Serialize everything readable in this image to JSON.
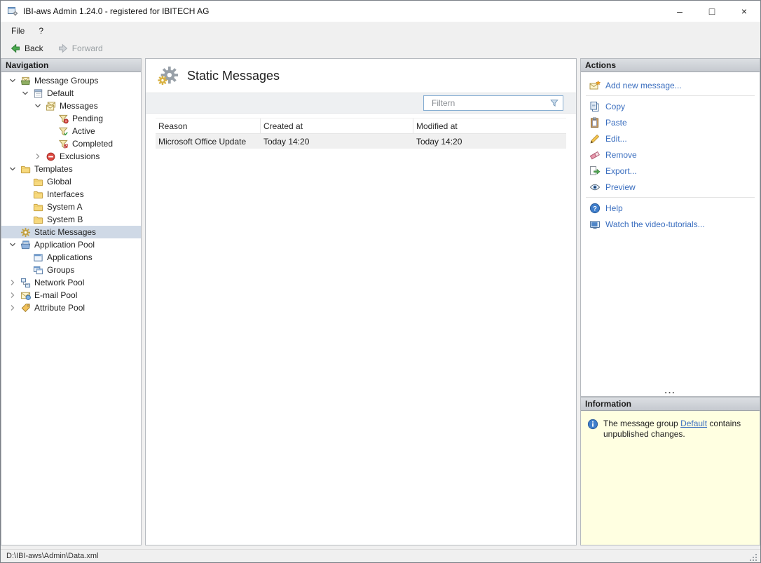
{
  "colors": {
    "action_link_blue": "#3a6ebf",
    "info_panel_bg": "#ffffe1",
    "selected_tree_item_bg": "#cfd9e6",
    "panel_header_gradient_top": "#dcdfe3",
    "panel_header_gradient_bottom": "#c5c9cf",
    "back_arrow_green": "#4aa94f",
    "row_highlight_gray": "#f0f0f0"
  },
  "window": {
    "title": "IBI-aws Admin 1.24.0 - registered for IBITECH AG",
    "controls": {
      "minimize": "–",
      "maximize": "□",
      "close": "×"
    }
  },
  "menu_bar": {
    "items": [
      {
        "label": "File"
      },
      {
        "label": "?"
      }
    ]
  },
  "toolbar": {
    "back_label": "Back",
    "forward_label": "Forward",
    "forward_enabled": false
  },
  "navigation": {
    "header": "Navigation",
    "tree": [
      {
        "label": "Message Groups",
        "icon": "message-groups-icon",
        "level": 0,
        "state": "expanded"
      },
      {
        "label": "Default",
        "icon": "message-group-icon",
        "level": 1,
        "state": "expanded"
      },
      {
        "label": "Messages",
        "icon": "messages-icon",
        "level": 2,
        "state": "expanded"
      },
      {
        "label": "Pending",
        "icon": "pending-filter-icon",
        "level": 3,
        "state": "leaf"
      },
      {
        "label": "Active",
        "icon": "active-filter-icon",
        "level": 3,
        "state": "leaf"
      },
      {
        "label": "Completed",
        "icon": "completed-filter-icon",
        "level": 3,
        "state": "leaf"
      },
      {
        "label": "Exclusions",
        "icon": "exclusions-icon",
        "level": 2,
        "state": "collapsed"
      },
      {
        "label": "Templates",
        "icon": "folder-icon",
        "level": 0,
        "state": "expanded"
      },
      {
        "label": "Global",
        "icon": "folder-icon",
        "level": 1,
        "state": "leaf"
      },
      {
        "label": "Interfaces",
        "icon": "folder-icon",
        "level": 1,
        "state": "leaf"
      },
      {
        "label": "System A",
        "icon": "folder-icon",
        "level": 1,
        "state": "leaf"
      },
      {
        "label": "System B",
        "icon": "folder-icon",
        "level": 1,
        "state": "leaf"
      },
      {
        "label": "Static Messages",
        "icon": "gear-icon",
        "level": 0,
        "state": "leaf",
        "selected": true
      },
      {
        "label": "Application Pool",
        "icon": "application-pool-icon",
        "level": 0,
        "state": "expanded"
      },
      {
        "label": "Applications",
        "icon": "applications-icon",
        "level": 1,
        "state": "leaf"
      },
      {
        "label": "Groups",
        "icon": "groups-icon",
        "level": 1,
        "state": "leaf"
      },
      {
        "label": "Network Pool",
        "icon": "network-pool-icon",
        "level": 0,
        "state": "collapsed"
      },
      {
        "label": "E-mail Pool",
        "icon": "email-pool-icon",
        "level": 0,
        "state": "collapsed"
      },
      {
        "label": "Attribute Pool",
        "icon": "attribute-pool-icon",
        "level": 0,
        "state": "collapsed"
      }
    ]
  },
  "main": {
    "title": "Static Messages",
    "title_icon": "gears-icon",
    "filter": {
      "placeholder": "Filtern",
      "icon": "filter-funnel-icon"
    },
    "table": {
      "columns": [
        "Reason",
        "Created at",
        "Modified at"
      ],
      "rows": [
        {
          "reason": "Microsoft Office Update",
          "created_at": "Today 14:20",
          "modified_at": "Today 14:20"
        }
      ]
    }
  },
  "actions": {
    "header": "Actions",
    "overflow": "...",
    "groups": [
      {
        "items": [
          {
            "label": "Add new message...",
            "icon": "new-message-icon"
          }
        ]
      },
      {
        "items": [
          {
            "label": "Copy",
            "icon": "copy-icon"
          },
          {
            "label": "Paste",
            "icon": "paste-icon"
          },
          {
            "label": "Edit...",
            "icon": "edit-pencil-icon"
          },
          {
            "label": "Remove",
            "icon": "remove-eraser-icon"
          },
          {
            "label": "Export...",
            "icon": "export-arrow-icon"
          },
          {
            "label": "Preview",
            "icon": "preview-eye-icon"
          }
        ]
      },
      {
        "items": [
          {
            "label": "Help",
            "icon": "help-icon"
          },
          {
            "label": "Watch the video-tutorials...",
            "icon": "video-tutorials-icon"
          }
        ]
      }
    ]
  },
  "information": {
    "header": "Information",
    "message_prefix": "The message group ",
    "link_text": "Default",
    "message_suffix": " contains unpublished changes."
  },
  "status_bar": {
    "path": "D:\\IBI-aws\\Admin\\Data.xml"
  }
}
